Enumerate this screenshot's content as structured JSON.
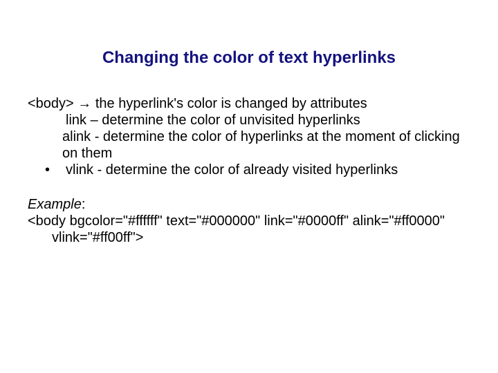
{
  "title": "Changing the color of text hyperlinks",
  "p1a": "<body> ",
  "arrow": "→",
  "p1b": " the hyperlink's color is changed by attributes",
  "p2": "link – determine the color of unvisited hyperlinks",
  "p3": "alink - determine the color of hyperlinks at the moment of clicking on them",
  "bullet": "•",
  "p4": "vlink - determine the color of already visited hyperlinks",
  "exampleLabel": "Example",
  "colon": ":",
  "code": "<body bgcolor=\"#ffffff\" text=\"#000000\" link=\"#0000ff\" alink=\"#ff0000\" vlink=\"#ff00ff\">"
}
